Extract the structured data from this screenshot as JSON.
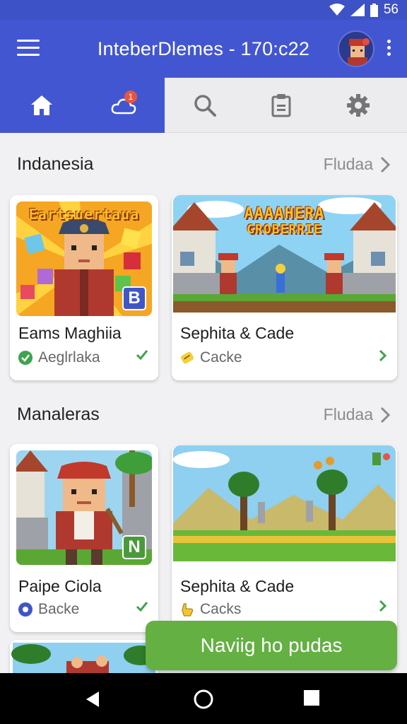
{
  "status_bar": {
    "time": "56"
  },
  "app_bar": {
    "title": "InteberDlemes - 170:c22"
  },
  "tabs": [
    {
      "name": "home",
      "icon": "home-icon",
      "active": true
    },
    {
      "name": "notifications",
      "icon": "cloud-notification-icon",
      "badge": "1"
    },
    {
      "name": "search",
      "icon": "search-icon"
    },
    {
      "name": "clipboard",
      "icon": "clipboard-icon"
    },
    {
      "name": "settings",
      "icon": "gear-icon"
    }
  ],
  "sections": [
    {
      "title": "Indanesia",
      "link": "Fludaa",
      "cards": [
        {
          "title": "Eams Maghiia",
          "subtitle": "Aeglrlaka",
          "sub_icon": "check-circle-icon",
          "action_icon": "check-icon",
          "banner": "Eartsuertaua",
          "tag": "B",
          "tag_color": "#3f56c9"
        },
        {
          "title": "Sephita & Cade",
          "subtitle": "Cacke",
          "sub_icon": "ticket-icon",
          "action_icon": "chevron-right-icon",
          "banner_line1": "AAAAHERA",
          "banner_line2": "GROBERRIE"
        }
      ]
    },
    {
      "title": "Manaleras",
      "link": "Fludaa",
      "cards": [
        {
          "title": "Paipe Ciola",
          "subtitle": "Backe",
          "sub_icon": "location-pin-icon",
          "action_icon": "check-icon",
          "tag": "N",
          "tag_color": "#4a9a3c"
        },
        {
          "title": "Sephita & Cade",
          "subtitle": "Cacks",
          "sub_icon": "hand-icon",
          "action_icon": "chevron-right-icon"
        }
      ]
    }
  ],
  "toast": {
    "text": "Naviig ho pudas"
  },
  "colors": {
    "primary": "#4356d2",
    "accent_green": "#64b043",
    "check_green": "#3fa34d"
  }
}
